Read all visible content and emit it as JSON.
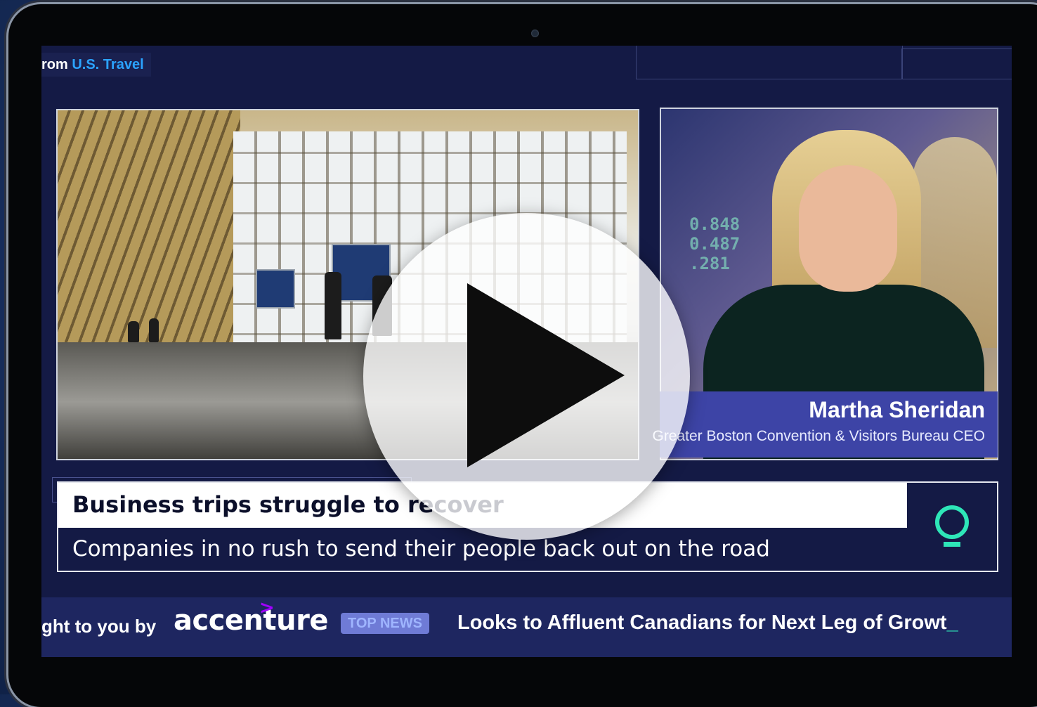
{
  "video": {
    "source_prefix": "rom ",
    "source_org": "U.S. Travel",
    "anchor_ticker_numbers": [
      "0.848",
      "0.487",
      ".281"
    ],
    "lower_third": {
      "name": "Martha Sheridan",
      "title": "Greater Boston Convention & Visitors Bureau CEO"
    },
    "headline": "Business trips struggle to recover",
    "subhead": "Companies in no rush to send their people back out on the road",
    "ticker": {
      "sponsor_prefix": "ght to you by",
      "sponsor_name": "accenture",
      "sponsor_mark": ">",
      "badge": "TOP NEWS",
      "text": "Looks to Affluent Canadians for Next Leg of Growt",
      "cursor": "_"
    }
  },
  "colors": {
    "screen_bg": "#141a45",
    "accent_blue": "#2ba3ff",
    "lower_third_bg": "#3d44a6",
    "accent_green": "#2ee6b8",
    "sponsor_purple": "#a100ff"
  },
  "icons": {
    "play": "play-icon",
    "logo": "q-logo-icon"
  }
}
